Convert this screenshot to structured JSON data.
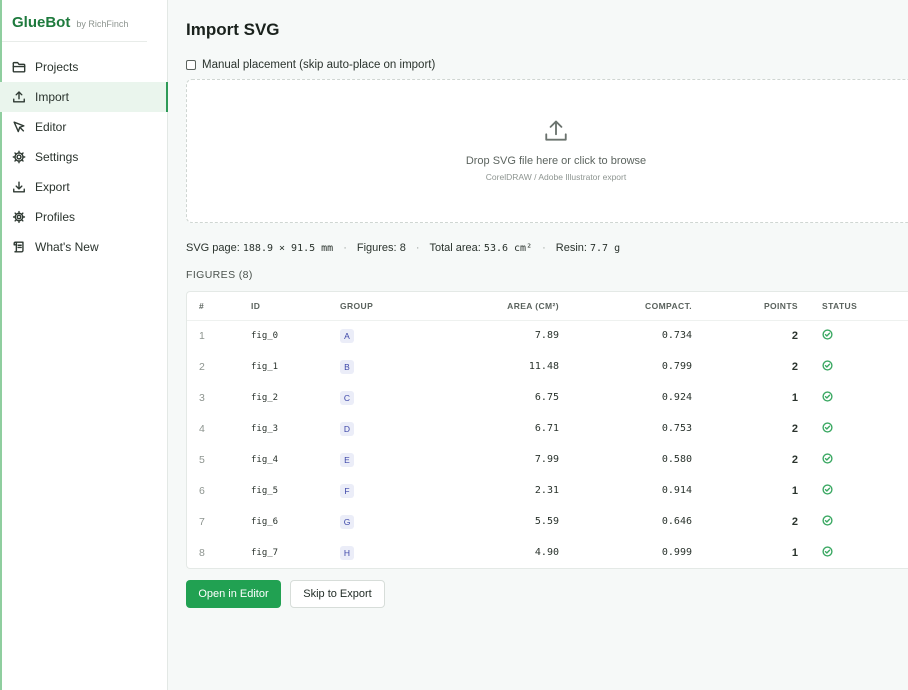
{
  "brand": {
    "name": "GlueBot",
    "by": "by RichFinch"
  },
  "sidebar": {
    "items": [
      {
        "label": "Projects",
        "icon": "folder-icon"
      },
      {
        "label": "Import",
        "icon": "upload-icon",
        "active": true
      },
      {
        "label": "Editor",
        "icon": "cursor-icon"
      },
      {
        "label": "Settings",
        "icon": "gear-icon"
      },
      {
        "label": "Export",
        "icon": "download-icon"
      },
      {
        "label": "Profiles",
        "icon": "profile-gear-icon"
      },
      {
        "label": "What's New",
        "icon": "scroll-icon"
      }
    ]
  },
  "page": {
    "title": "Import SVG"
  },
  "manual": {
    "label": "Manual placement (skip auto-place on import)",
    "checked": false
  },
  "dropzone": {
    "main": "Drop SVG file here or click to browse",
    "sub": "CorelDRAW / Adobe Illustrator export"
  },
  "stats": {
    "page_label": "SVG page:",
    "page_value": "188.9 × 91.5 mm",
    "figures_label": "Figures:",
    "figures_value": "8",
    "area_label": "Total area:",
    "area_value": "53.6 cm²",
    "resin_label": "Resin:",
    "resin_value": "7.7 g"
  },
  "figures_heading": "FIGURES (8)",
  "table": {
    "columns": [
      "#",
      "ID",
      "GROUP",
      "AREA (CM²)",
      "COMPACT.",
      "POINTS",
      "STATUS"
    ],
    "rows": [
      {
        "num": "1",
        "id": "fig_0",
        "group": "A",
        "area": "7.89",
        "compact": "0.734",
        "points": "2",
        "status": "ok"
      },
      {
        "num": "2",
        "id": "fig_1",
        "group": "B",
        "area": "11.48",
        "compact": "0.799",
        "points": "2",
        "status": "ok"
      },
      {
        "num": "3",
        "id": "fig_2",
        "group": "C",
        "area": "6.75",
        "compact": "0.924",
        "points": "1",
        "status": "ok"
      },
      {
        "num": "4",
        "id": "fig_3",
        "group": "D",
        "area": "6.71",
        "compact": "0.753",
        "points": "2",
        "status": "ok"
      },
      {
        "num": "5",
        "id": "fig_4",
        "group": "E",
        "area": "7.99",
        "compact": "0.580",
        "points": "2",
        "status": "ok"
      },
      {
        "num": "6",
        "id": "fig_5",
        "group": "F",
        "area": "2.31",
        "compact": "0.914",
        "points": "1",
        "status": "ok"
      },
      {
        "num": "7",
        "id": "fig_6",
        "group": "G",
        "area": "5.59",
        "compact": "0.646",
        "points": "2",
        "status": "ok"
      },
      {
        "num": "8",
        "id": "fig_7",
        "group": "H",
        "area": "4.90",
        "compact": "0.999",
        "points": "1",
        "status": "ok"
      }
    ]
  },
  "actions": {
    "open_editor": "Open in Editor",
    "skip_export": "Skip to Export"
  },
  "colors": {
    "brand": "#1e7a3d",
    "primary": "#21a152",
    "badge_bg": "#ebedf8",
    "badge_fg": "#3c46a8",
    "ok": "#3aa862"
  }
}
